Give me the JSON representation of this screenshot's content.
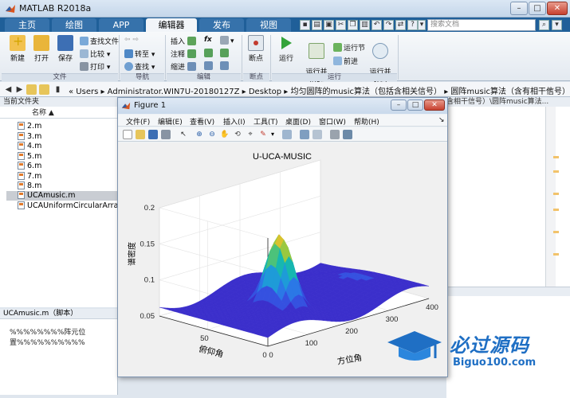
{
  "window": {
    "title": "MATLAB R2018a"
  },
  "tabs": [
    "主页",
    "绘图",
    "APP",
    "编辑器",
    "发布",
    "视图"
  ],
  "active_tab": "编辑器",
  "search": {
    "placeholder": "搜索文档"
  },
  "ribbon": {
    "file": {
      "new": "新建",
      "open": "打开",
      "save": "保存",
      "find_files": "查找文件",
      "compare": "比较",
      "print": "打印",
      "group": "文件"
    },
    "navigate": {
      "goto": "转至",
      "find": "查找",
      "group": "导航"
    },
    "edit": {
      "insert": "插入",
      "comment": "注释",
      "indent": "缩进",
      "fx": "fx",
      "group": "编辑"
    },
    "breakpoints": {
      "label": "断点",
      "group": "断点"
    },
    "run": {
      "run": "运行",
      "run_advance": "运行并\n前进",
      "run_section": "运行节",
      "advance": "前进",
      "run_time": "运行并\n计时",
      "group": "运行"
    }
  },
  "address": {
    "path": "« Users ▸ Administrator.WIN7U-20180127Z ▸ Desktop ▸ 均匀圆阵的music算法（包括含相关信号） ▸ 圆阵music算法（含有相干信号）",
    "right_path": "含相干信号）\\圆阵music算法..."
  },
  "current_folder": {
    "title": "当前文件夹",
    "column": "名称 ▲",
    "files": [
      "2.m",
      "3.m",
      "4.m",
      "5.m",
      "6.m",
      "7.m",
      "8.m",
      "UCAmusic.m",
      "UCAUniformCircularArrayMUSIC.m"
    ],
    "selected": "UCAmusic.m"
  },
  "details": {
    "title": "UCAmusic.m（脚本）",
    "line1": "%%%%%%%%阵元位",
    "line2": "置%%%%%%%%%%"
  },
  "figure": {
    "title": "Figure 1",
    "menus": [
      "文件(F)",
      "编辑(E)",
      "查看(V)",
      "插入(I)",
      "工具(T)",
      "桌面(D)",
      "窗口(W)",
      "帮助(H)"
    ]
  },
  "chart_data": {
    "type": "surface",
    "title": "U-UCA-MUSIC",
    "zlabel": "谱密度",
    "xlabel": "方位角",
    "ylabel": "俯仰角",
    "x_ticks": [
      0,
      100,
      200,
      300,
      400
    ],
    "y_ticks": [
      0,
      50
    ],
    "z_ticks": [
      0.05,
      0.1,
      0.15,
      0.2
    ],
    "xlim": [
      0,
      400
    ],
    "ylim": [
      0,
      90
    ],
    "zlim": [
      0.05,
      0.2
    ],
    "peak": {
      "azimuth": 150,
      "elevation": 40,
      "value": 0.165
    },
    "colormap": "parula"
  },
  "watermark": {
    "text": "必过源码",
    "url": "Biguo100.com"
  }
}
